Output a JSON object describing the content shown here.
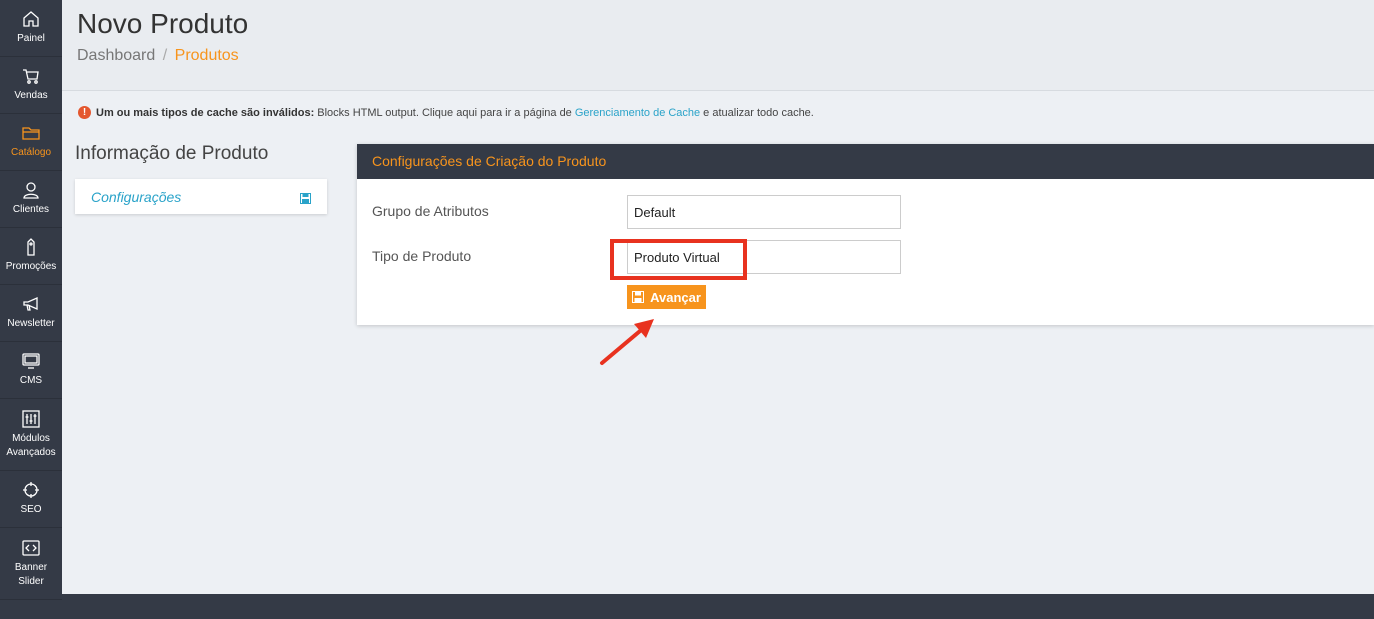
{
  "sidebar": {
    "items": [
      {
        "label": "Painel",
        "icon": "home-icon"
      },
      {
        "label": "Vendas",
        "icon": "cart-icon"
      },
      {
        "label": "Catálogo",
        "icon": "folder-icon",
        "active": true
      },
      {
        "label": "Clientes",
        "icon": "user-icon"
      },
      {
        "label": "Promoções",
        "icon": "tag-icon"
      },
      {
        "label": "Newsletter",
        "icon": "megaphone-icon"
      },
      {
        "label": "CMS",
        "icon": "monitor-icon"
      },
      {
        "label": "Módulos\nAvançados",
        "icon": "sliders-icon"
      },
      {
        "label": "SEO",
        "icon": "target-icon"
      },
      {
        "label": "Banner\nSlider",
        "icon": "code-icon"
      }
    ]
  },
  "header": {
    "title": "Novo Produto",
    "breadcrumb": {
      "home": "Dashboard",
      "separator": "/",
      "current": "Produtos"
    }
  },
  "alert": {
    "strong": "Um ou mais tipos de cache são inválidos:",
    "text_before": "Blocks HTML output. Clique aqui para ir a página de",
    "link": "Gerenciamento de Cache",
    "text_after": "e atualizar todo cache."
  },
  "left_panel": {
    "title": "Informação de Produto",
    "tab_label": "Configurações"
  },
  "card": {
    "title": "Configurações de Criação do Produto",
    "fields": [
      {
        "label": "Grupo de Atributos",
        "value": "Default"
      },
      {
        "label": "Tipo de Produto",
        "value": "Produto Virtual"
      }
    ],
    "button_label": "Avançar"
  },
  "colors": {
    "accent": "#f7941d",
    "sidebar_bg": "#343a46",
    "link": "#2aa3c9",
    "highlight": "#e8321f"
  }
}
